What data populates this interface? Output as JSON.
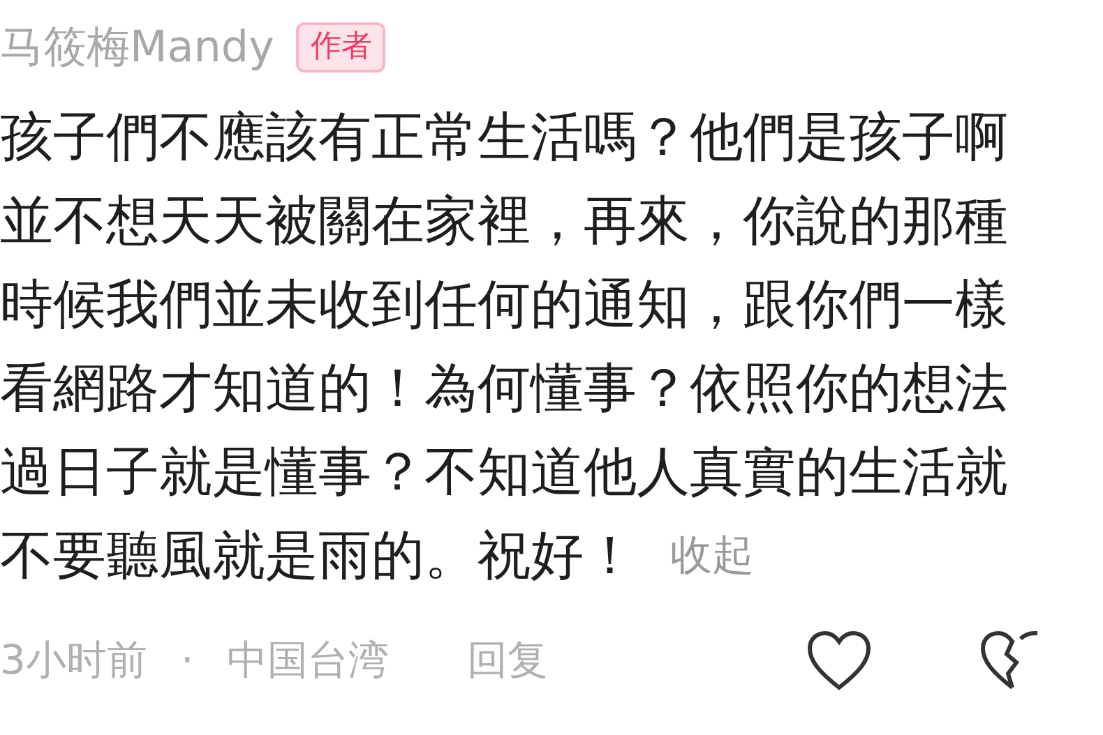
{
  "author": {
    "name": "马筱梅Mandy",
    "badge": "作者"
  },
  "comment": {
    "lines": [
      "孩子們不應該有正常生活嗎？他們是孩子啊",
      "並不想天天被關在家裡，再來，你說的那種",
      "時候我們並未收到任何的通知，跟你們一樣",
      "看網路才知道的！為何懂事？依照你的想法",
      "過日子就是懂事？不知道他人真實的生活就",
      "不要聽風就是雨的。祝好！"
    ],
    "collapse_link": "收起"
  },
  "footer": {
    "time": "3小时前",
    "separator": "·",
    "location": "中国台湾",
    "reply": "回复"
  }
}
